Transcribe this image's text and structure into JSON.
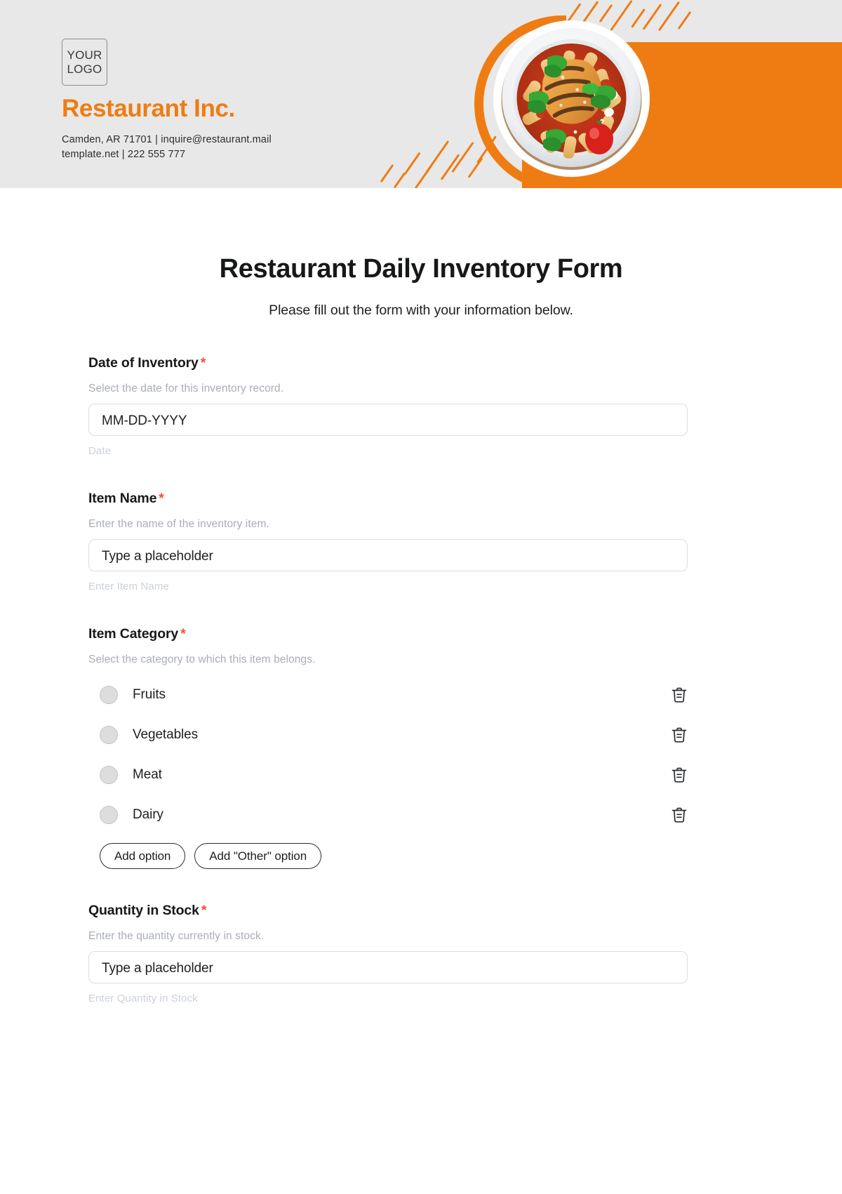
{
  "header": {
    "logo_line1": "YOUR",
    "logo_line2": "LOGO",
    "company_name": "Restaurant Inc.",
    "contact_line1": "Camden, AR 71701 | inquire@restaurant.mail",
    "contact_line2": "template.net | 222 555 777",
    "accent_color": "#ef7c12",
    "background_color": "#e8e8e8",
    "photo_alt": "pasta-bowl-photo"
  },
  "form": {
    "title": "Restaurant Daily Inventory Form",
    "subtitle": "Please fill out the form with your information below.",
    "required_marker": "*",
    "required_color": "#f1512e",
    "fields": [
      {
        "name": "date-of-inventory",
        "label": "Date of Inventory",
        "required": true,
        "hint": "Select the date for this inventory record.",
        "type": "date",
        "placeholder": "MM-DD-YYYY",
        "sub": "Date"
      },
      {
        "name": "item-name",
        "label": "Item Name",
        "required": true,
        "hint": "Enter the name of the inventory item.",
        "type": "text",
        "placeholder": "Type a placeholder",
        "sub": "Enter Item Name"
      },
      {
        "name": "item-category",
        "label": "Item Category",
        "required": true,
        "hint": "Select the category to which this item belongs.",
        "type": "radio",
        "options": [
          "Fruits",
          "Vegetables",
          "Meat",
          "Dairy"
        ],
        "add_option_label": "Add option",
        "add_other_label": "Add \"Other\" option"
      },
      {
        "name": "quantity-in-stock",
        "label": "Quantity in Stock",
        "required": true,
        "hint": "Enter the quantity currently in stock.",
        "type": "text",
        "placeholder": "Type a placeholder",
        "sub": "Enter Quantity in Stock"
      }
    ]
  }
}
